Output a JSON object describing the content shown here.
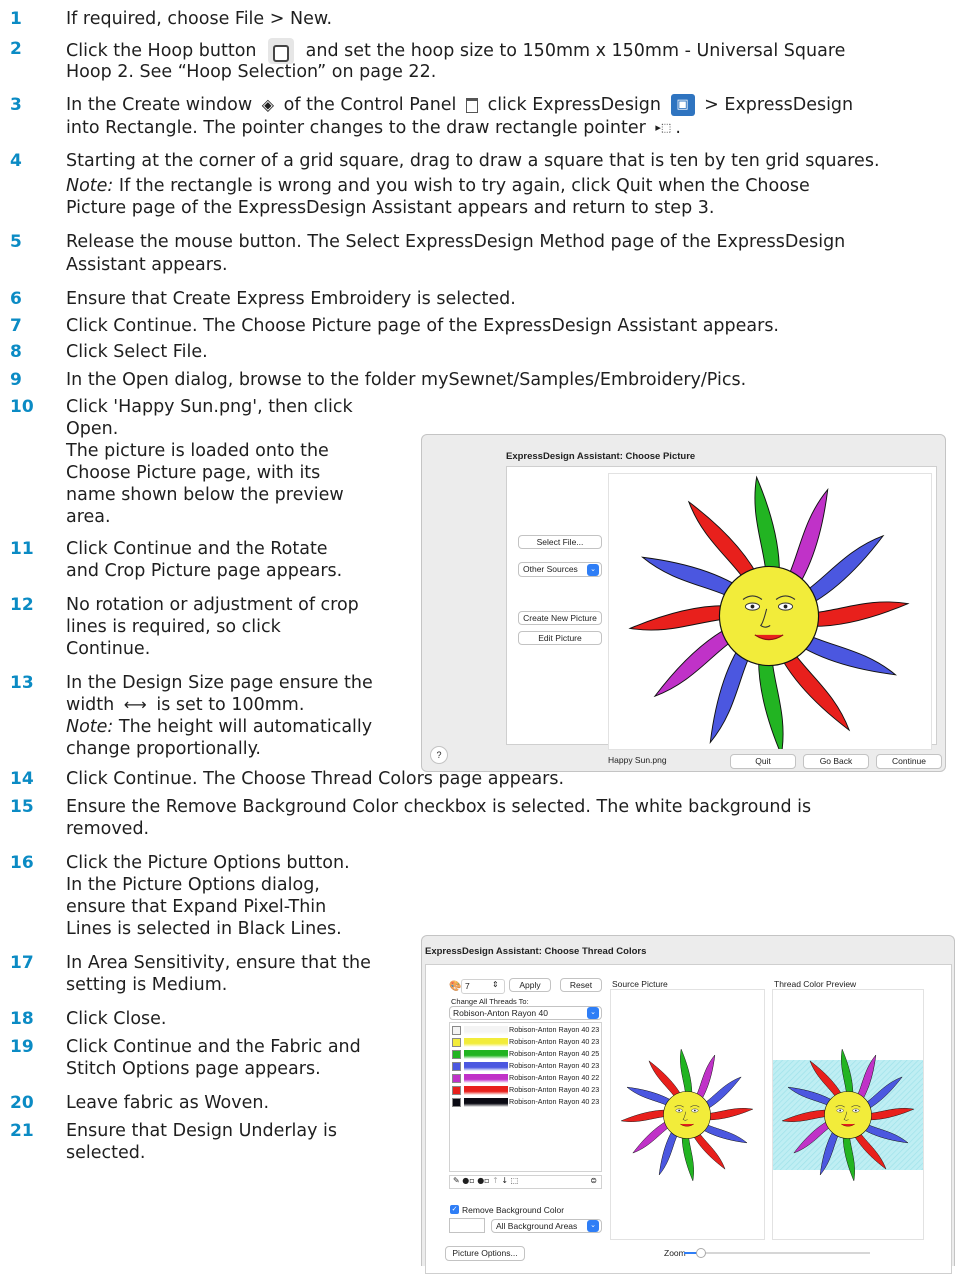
{
  "steps": [
    {
      "n": "1",
      "t": "If required, choose File > New."
    },
    {
      "n": "2",
      "a": "Click the Hoop button",
      "b": "and set the hoop size to 150mm x 150mm - Universal Square",
      "c": "Hoop 2. See “Hoop Selection” on page 22."
    },
    {
      "n": "3",
      "a": "In the Create window",
      "b": "of the Control Panel",
      "c": "click ExpressDesign",
      "d": "> ExpressDesign",
      "e": "into Rectangle. The pointer changes to the draw rectangle pointer",
      "f": "."
    },
    {
      "n": "4",
      "a": "Starting at the corner of a grid square, drag to draw a square that is ten by ten grid squares.",
      "note": "Note:",
      "b": "If the rectangle is wrong and you wish to try again, click Quit when the Choose",
      "c": "Picture page of the ExpressDesign Assistant appears and return to step 3."
    },
    {
      "n": "5",
      "a": "Release the mouse button. The Select ExpressDesign Method page of the ExpressDesign",
      "b": "Assistant appears."
    },
    {
      "n": "6",
      "t": "Ensure that Create Express Embroidery is selected."
    },
    {
      "n": "7",
      "t": "Click Continue. The Choose Picture page of the ExpressDesign Assistant appears."
    },
    {
      "n": "8",
      "t": "Click Select File."
    },
    {
      "n": "9",
      "t": "In the Open dialog, browse to the folder mySewnet/Samples/Embroidery/Pics."
    },
    {
      "n": "10",
      "lines": [
        "Click 'Happy Sun.png', then click",
        "Open.",
        "The picture is loaded onto the",
        "Choose Picture page, with its",
        "name shown below the preview",
        "area."
      ]
    },
    {
      "n": "11",
      "lines": [
        "Click Continue and the Rotate",
        "and Crop Picture page appears."
      ]
    },
    {
      "n": "12",
      "lines": [
        "No rotation or adjustment of crop",
        "lines is required, so click",
        "Continue."
      ]
    },
    {
      "n": "13",
      "a": "In the Design Size page ensure the",
      "b": "width",
      "c": "is set to 100mm.",
      "note": "Note:",
      "d": "The height will automatically",
      "e": "change proportionally."
    },
    {
      "n": "14",
      "t": "Click Continue. The Choose Thread Colors page appears."
    },
    {
      "n": "15",
      "a": "Ensure the Remove Background Color checkbox is selected. The white background is",
      "b": "removed."
    },
    {
      "n": "16",
      "lines": [
        "Click the Picture Options button.",
        "In the Picture Options dialog,",
        "ensure that Expand Pixel-Thin",
        "Lines is selected in Black Lines."
      ]
    },
    {
      "n": "17",
      "lines": [
        "In Area Sensitivity, ensure that the",
        "setting is Medium."
      ]
    },
    {
      "n": "18",
      "t": "Click Close."
    },
    {
      "n": "19",
      "lines": [
        "Click Continue and the Fabric and",
        "Stitch Options page appears."
      ]
    },
    {
      "n": "20",
      "t": "Leave fabric as Woven."
    },
    {
      "n": "21",
      "lines": [
        "Ensure that Design Underlay is",
        "selected."
      ]
    }
  ],
  "choose_picture": {
    "title": "ExpressDesign Assistant: Choose Picture",
    "select_file": "Select File...",
    "other_sources": "Other Sources",
    "create_new": "Create New Picture",
    "edit_picture": "Edit Picture",
    "filename": "Happy Sun.png",
    "help": "?",
    "quit": "Quit",
    "go_back": "Go Back",
    "continue": "Continue"
  },
  "thread_colors": {
    "title": "ExpressDesign Assistant: Choose Thread Colors",
    "count": "7",
    "apply": "Apply",
    "reset": "Reset",
    "source_picture": "Source Picture",
    "thread_preview": "Thread Color Preview",
    "change_all": "Change All Threads To:",
    "range": "Robison-Anton Rayon 40",
    "threads": [
      {
        "name": "Robison-Anton Rayon 40 23",
        "color": "#f4f4f4"
      },
      {
        "name": "Robison-Anton Rayon 40 23",
        "color": "#f2ec3a"
      },
      {
        "name": "Robison-Anton Rayon 40 25",
        "color": "#22b422"
      },
      {
        "name": "Robison-Anton Rayon 40 23",
        "color": "#4b57e0"
      },
      {
        "name": "Robison-Anton Rayon 40 22",
        "color": "#c032c8"
      },
      {
        "name": "Robison-Anton Rayon 40 23",
        "color": "#e8201c"
      },
      {
        "name": "Robison-Anton Rayon 40 23",
        "color": "#0b0b14"
      }
    ],
    "remove_bg": "Remove Background Color",
    "bg_areas": "All Background Areas",
    "picture_options": "Picture Options...",
    "zoom": "Zoom"
  }
}
